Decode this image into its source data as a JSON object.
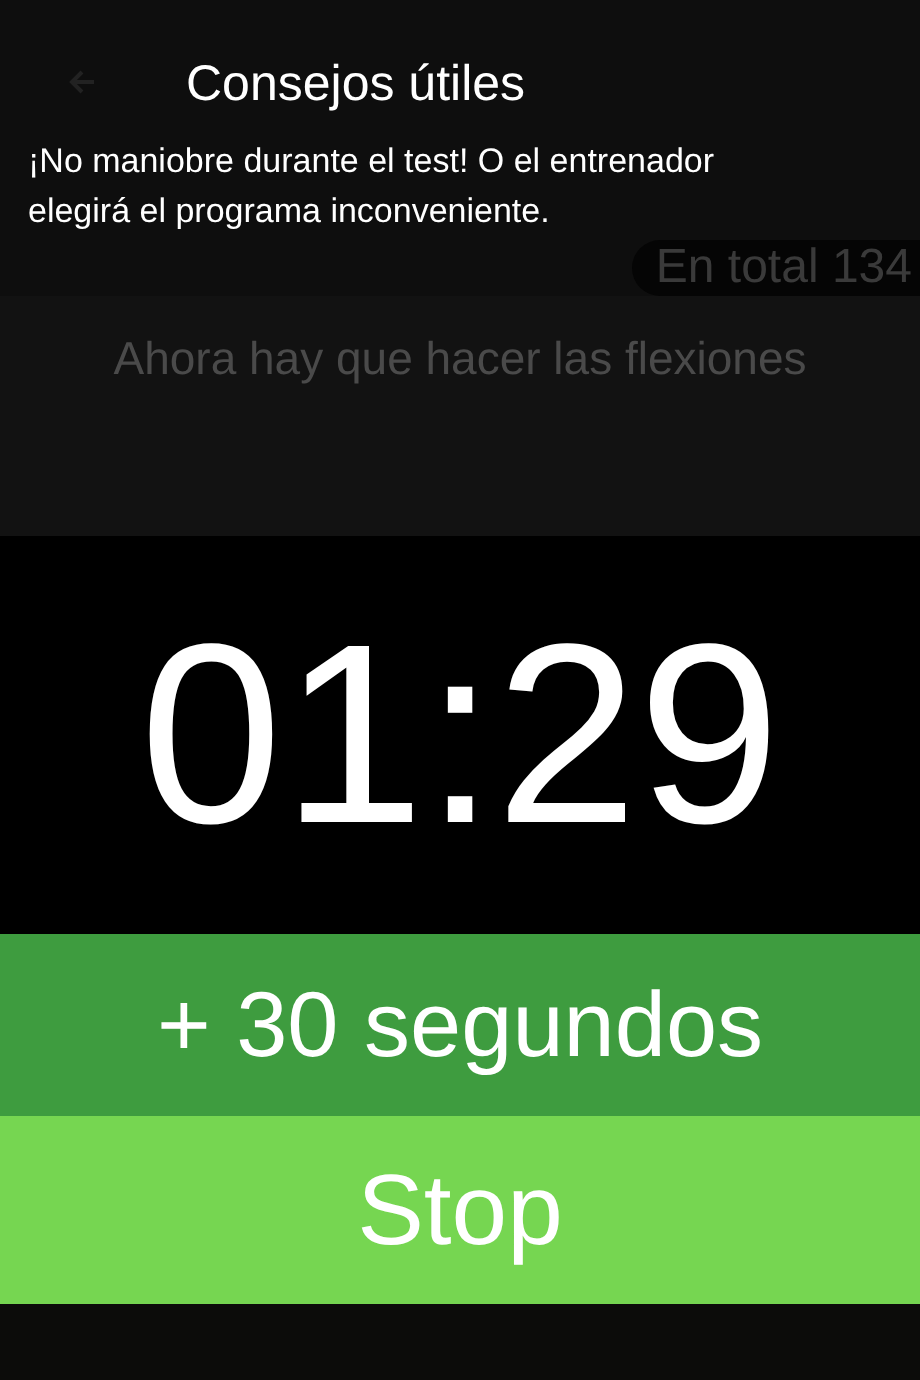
{
  "tip_banner": {
    "title": "Consejos útiles",
    "message": "¡No maniobre durante el test! O el entrenador elegirá el programa inconveniente."
  },
  "background": {
    "total": "En total 134",
    "instruction": "Ahora hay que hacer las flexiones"
  },
  "timer": {
    "time": "01:29"
  },
  "buttons": [
    {
      "kind": "add",
      "label": "+ 30 segundos"
    },
    {
      "kind": "stop",
      "label": "Stop"
    }
  ]
}
